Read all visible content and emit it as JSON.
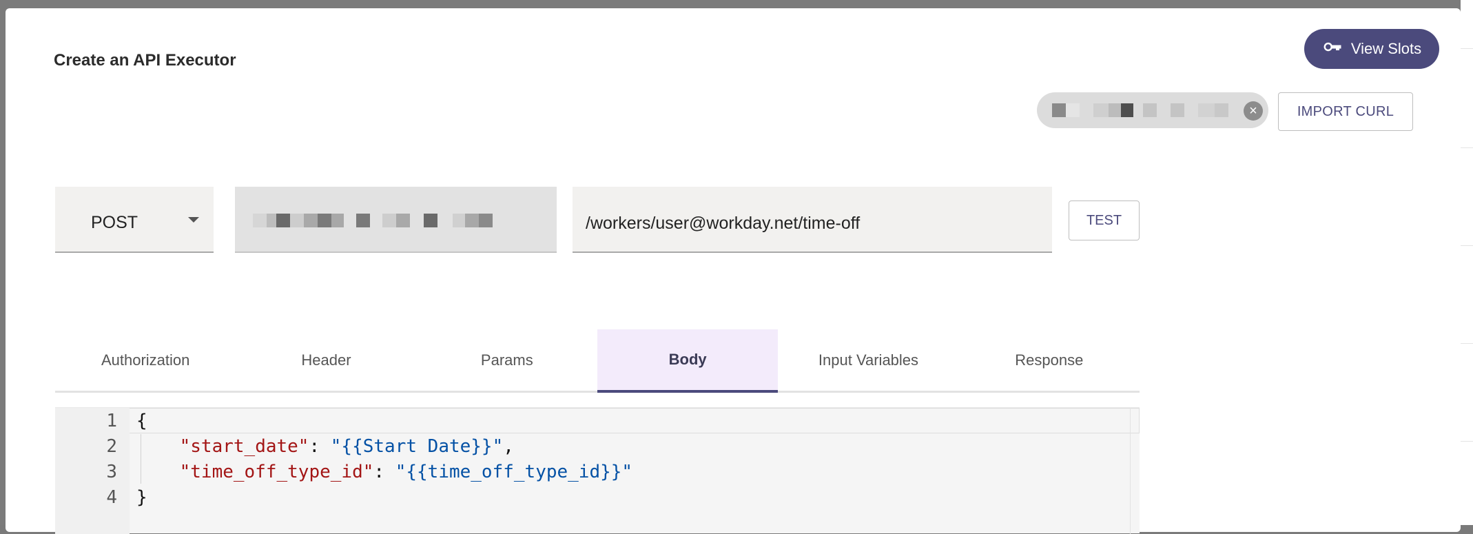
{
  "modal": {
    "title": "Create an API Executor",
    "view_slots_label": "View Slots",
    "import_curl_label": "IMPORT CURL",
    "test_label": "TEST"
  },
  "request": {
    "method": "POST",
    "path": "/workers/user@workday.net/time-off"
  },
  "tabs": [
    {
      "label": "Authorization",
      "active": false
    },
    {
      "label": "Header",
      "active": false
    },
    {
      "label": "Params",
      "active": false
    },
    {
      "label": "Body",
      "active": true
    },
    {
      "label": "Input Variables",
      "active": false
    },
    {
      "label": "Response",
      "active": false
    }
  ],
  "editor": {
    "line_numbers": [
      "1",
      "2",
      "3",
      "4"
    ],
    "lines": [
      {
        "parts": [
          {
            "t": "{",
            "c": "p"
          }
        ]
      },
      {
        "parts": [
          {
            "t": "    ",
            "c": "p"
          },
          {
            "t": "\"start_date\"",
            "c": "k"
          },
          {
            "t": ": ",
            "c": "p"
          },
          {
            "t": "\"{{Start Date}}\"",
            "c": "s"
          },
          {
            "t": ",",
            "c": "p"
          }
        ]
      },
      {
        "parts": [
          {
            "t": "    ",
            "c": "p"
          },
          {
            "t": "\"time_off_type_id\"",
            "c": "k"
          },
          {
            "t": ": ",
            "c": "p"
          },
          {
            "t": "\"{{time_off_type_id}}\"",
            "c": "s"
          }
        ]
      },
      {
        "parts": [
          {
            "t": "}",
            "c": "p"
          }
        ]
      }
    ]
  },
  "colors": {
    "accent": "#4b4a7c",
    "active_tab_bg": "#f3ebfb",
    "json_key": "#a31515",
    "json_string": "#0451a5"
  },
  "icons": {
    "view_slots": "key-icon",
    "chip_clear": "close-circle-icon",
    "method_dropdown": "caret-down-icon"
  }
}
